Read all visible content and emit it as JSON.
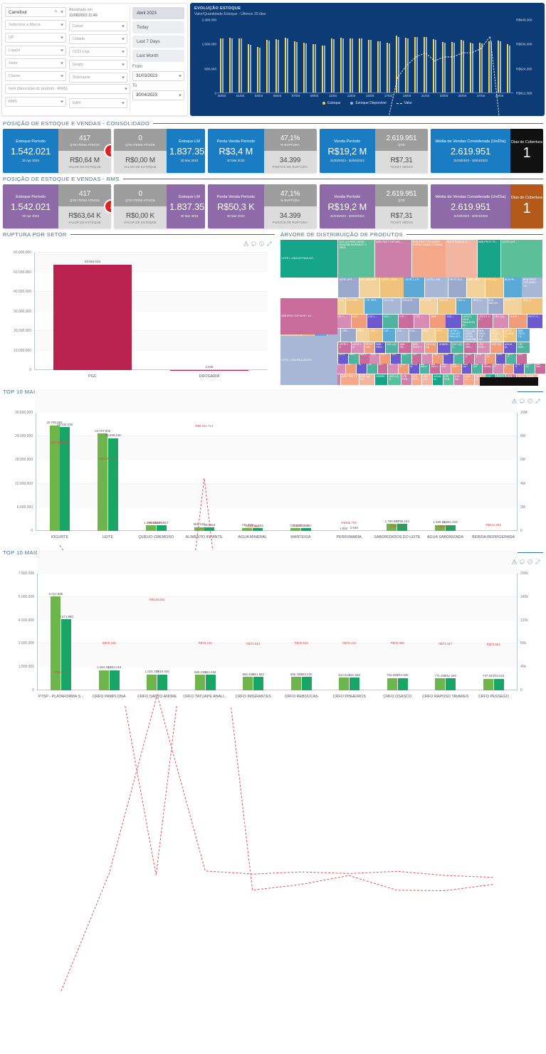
{
  "filters": {
    "account": {
      "value": "Carrefour",
      "placeholder": "Conta"
    },
    "updated": {
      "line1": "Atualizado em",
      "line2": "11/08/2023  11:49"
    },
    "selects": [
      {
        "label": "Selecione a Marca"
      },
      {
        "label": "Canal"
      },
      {
        "label": "UF"
      },
      {
        "label": "Cidade"
      },
      {
        "label": "Loja(s)"
      },
      {
        "label": "COD Loja"
      },
      {
        "label": "Setor"
      },
      {
        "label": "Grupo"
      },
      {
        "label": "Classe"
      },
      {
        "label": "Subclasse"
      }
    ],
    "item_select": {
      "label": "Item (descrição do produto - RMS)"
    },
    "rms_select": {
      "label": "RMS"
    },
    "ean_select": {
      "label": "EAN"
    },
    "presets": [
      "Abril 2023",
      "Today",
      "Last 7 Days",
      "Last Month"
    ],
    "selected_preset": "Abril 2023",
    "from_label": "From",
    "from_value": "31/03/2023",
    "to_label": "To",
    "to_value": "30/04/2023"
  },
  "evolution": {
    "title": "EVOLUÇÃO ESTOQUE",
    "subtitle": "Valor/Quantidade Estoque - Últimos 30 dias",
    "legend": [
      "Estoque",
      "Estoque Disponível",
      "Valor"
    ],
    "chart_data": {
      "type": "bar",
      "title": "EVOLUÇÃO ESTOQUE",
      "xlabel": "",
      "ylabel": "Quantidade Estoque",
      "ylim": [
        0,
        2400000
      ],
      "y_ticks": [
        "0",
        "800.000",
        "1.600.000",
        "2.400.000"
      ],
      "y2_ticks": [
        "R$612.000",
        "R$624.000",
        "R$636.000",
        "R$648.000"
      ],
      "y2lim": [
        612000,
        648000
      ],
      "grid": false,
      "legend_position": "bottom",
      "categories": [
        "30/03",
        "31/03",
        "01/04",
        "02/04",
        "03/04",
        "04/04",
        "05/04",
        "06/04",
        "07/04",
        "08/04",
        "09/04",
        "10/04",
        "11/04",
        "12/04",
        "13/04",
        "14/04",
        "15/04",
        "16/04",
        "17/04",
        "18/04",
        "19/04",
        "20/04",
        "21/04",
        "22/04",
        "23/04",
        "24/04",
        "25/04",
        "26/04",
        "27/04",
        "28/04",
        "29/04",
        "30/04"
      ],
      "tick_labels": [
        "30/03",
        "01/04",
        "03/04",
        "05/04",
        "07/04",
        "09/04",
        "11/04",
        "13/04",
        "15/04",
        "17/04",
        "19/04",
        "21/04",
        "23/04",
        "25/04",
        "27/04",
        "29/04"
      ],
      "series": [
        {
          "name": "Estoque",
          "color": "#f5d547",
          "values": [
            1800000,
            1810000,
            1805000,
            1600000,
            1520000,
            1750000,
            1760000,
            1810000,
            1700000,
            1660000,
            1610000,
            1570000,
            1800000,
            1810000,
            1800000,
            1800000,
            1750000,
            1710000,
            1660000,
            1880000,
            1810000,
            1840000,
            1850000,
            1760000,
            1680000,
            1680000,
            1740000,
            1660000,
            1660000,
            1700000,
            1720000,
            1600000
          ]
        },
        {
          "name": "Estoque Disponível",
          "color": "#8fb8dd",
          "values": [
            1790000,
            1800000,
            1800000,
            1590000,
            1500000,
            1720000,
            1740000,
            1800000,
            1680000,
            1640000,
            1600000,
            1550000,
            1780000,
            1800000,
            1790000,
            1790000,
            1740000,
            1700000,
            1640000,
            1850000,
            1800000,
            1830000,
            1840000,
            1740000,
            1660000,
            1660000,
            1720000,
            1640000,
            1640000,
            1690000,
            1700000,
            1570000
          ]
        },
        {
          "name": "Valor",
          "color": "#ffffff",
          "style": "dashed",
          "values": [
            620000,
            620000,
            620000,
            620000,
            620000,
            620500,
            621000,
            621000,
            621000,
            621500,
            622000,
            631000,
            633000,
            633500,
            634000,
            634500,
            634500,
            634000,
            636000,
            641000,
            642500,
            643500,
            644000,
            643000,
            643500,
            643500,
            644000,
            644000,
            644500,
            646000,
            636000,
            635000
          ]
        }
      ]
    }
  },
  "sections": {
    "consolidado": "POSIÇÃO DE ESTOQUE E VENDAS - CONSOLIDADO",
    "rms": "POSIÇÃO DE ESTOQUE E VENDAS - RMS",
    "ruptura": "RUPTURA POR SETOR",
    "arvore": "ÁRVORE DE DISTRIBUIÇÃO DE PRODUTOS",
    "top_grupo": "TOP 10 MAIORES ESTOQUES POR GRUPO",
    "top_loja": "TOP 10 MAIORES ESTOQUES POR LOJA"
  },
  "kpi_consolidado": {
    "accent": "#1a7dc4",
    "coverage_bg": "#111111",
    "cards": [
      {
        "label": "Estoque Período",
        "value": "1.542.021",
        "sub": "30 Apr 2023",
        "right_top_value": "417",
        "right_top_cap": "QTD ITENS ATIVOS",
        "right_bot_value": "R$0,64 M",
        "right_bot_cap": "VALOR DE ESTOQUE"
      },
      {
        "label": "Estoque LM",
        "value": "1.837.352",
        "sub": "30 Mar 2023",
        "left_top_value": "0",
        "left_top_cap": "QTD ITENS ATIVOS",
        "left_bot_value": "R$0,00 M",
        "left_bot_cap": "VALOR DE ESTOQUE"
      },
      {
        "label": "Perda Venda Período",
        "value": "R$3,4 M",
        "sub": "30 Mar 2023",
        "right_top_value": "47,1%",
        "right_top_cap": "% RUPTURA",
        "right_bot_value": "34.399",
        "right_bot_cap": "PONTOS DE RUPTURA"
      },
      {
        "label": "Venda Período",
        "value": "R$19,2 M",
        "sub": "31/03/2023 - 30/04/2023",
        "right_top_value": "2.619.951",
        "right_top_cap": "QTD",
        "right_bot_value": "R$7,31",
        "right_bot_cap": "TICKET MÉDIO"
      },
      {
        "label": "Média de Vendas Considerada (Un/Dia)",
        "value": "2.619.951",
        "sub": "31/03/2023 - 30/04/2023",
        "coverage_label": "Dias de Cobertura",
        "coverage_value": "1"
      }
    ]
  },
  "kpi_rms": {
    "accent": "#8e6ba8",
    "coverage_bg": "#b5591a",
    "cards": [
      {
        "label": "Estoque Período",
        "value": "1.542.021",
        "sub": "30 Apr 2023",
        "right_top_value": "417",
        "right_top_cap": "QTD ITENS ATIVOS",
        "right_bot_value": "R$63,64 K",
        "right_bot_cap": "VALOR DE ESTOQUE"
      },
      {
        "label": "Estoque LM",
        "value": "1.837.352",
        "sub": "30 Mar 2023",
        "left_top_value": "0",
        "left_top_cap": "QTD ITENS ATIVOS",
        "left_bot_value": "R$0,00 K",
        "left_bot_cap": "VALOR DE ESTOQUE"
      },
      {
        "label": "Perda Venda Período",
        "value": "R$50,3 K",
        "sub": "30 Mar 2023",
        "right_top_value": "47,1%",
        "right_top_cap": "% RUPTURA",
        "right_bot_value": "34.399",
        "right_bot_cap": "PONTOS DE RUPTURA"
      },
      {
        "label": "Venda Período",
        "value": "R$19,2 M",
        "sub": "31/03/2023 - 30/04/2023",
        "right_top_value": "2.619.951",
        "right_top_cap": "QTD",
        "right_bot_value": "R$7,31",
        "right_bot_cap": "TICKET MÉDIO"
      },
      {
        "label": "Média de Vendas Considerada (Un/Dia)",
        "value": "2.619.951",
        "sub": "31/03/2023 - 30/04/2023",
        "coverage_label": "Dias de Cobertura",
        "coverage_value": "1"
      }
    ]
  },
  "ruptura_chart": {
    "chart_data": {
      "type": "bar",
      "title": "RUPTURA POR SETOR",
      "xlabel": "",
      "ylabel": "",
      "ylim": [
        0,
        60000000
      ],
      "grid": true,
      "legend_position": "none",
      "y_ticks": [
        "0",
        "10.000.000",
        "20.000.000",
        "30.000.000",
        "40.000.000",
        "50.000.000",
        "60.000.000"
      ],
      "categories": [
        "PGC",
        "DROGARIA"
      ],
      "values": [
        53693615,
        2948
      ],
      "value_labels": [
        "53.693.615",
        "2.948"
      ],
      "color": "#b9214f"
    }
  },
  "treemap": {
    "chart_data": {
      "type": "heatmap",
      "title": "ÁRVORE DE DISTRIBUIÇÃO DE PRODUTOS",
      "labels": [
        "LEITE L VIDA INT PAULIST...",
        "IOG LIQ PARC DESN DANONE MORANGO 1 25KG",
        "BEB PROT TGP WH...",
        "BEB PROT TGP WHEY YOPRO MORA TP 250ML",
        "PETIT SUISSE D...",
        "BEB PROT TS...",
        "LEITE UHT ...",
        "LEITE UHT ...",
        "IOG NATURA...",
        "LEITE L VIDA...",
        "LEITE L V P...",
        "LEITE L VID...",
        "PETIT SUI...",
        "BEB PRO...",
        "IOG LIQ ...",
        "BEB PR...",
        "BEB PROT TGP WHEY YO...",
        "IOG LIQ DA...",
        "SOBRE...",
        "IOG LIQ S ...",
        "LTE FER...",
        "LTE FER...",
        "IOG LIQ ...",
        "AGUA M...",
        "LTE FER...",
        "IOG NA...",
        "IOG LI...",
        "REQ C...",
        "IOG NATUR...",
        "PETIT S...",
        "IOG LI...",
        "PETIT ...",
        "BEB IO...",
        "LTE F...",
        "IOG L...",
        "ACH...",
        "IOG L...",
        "IOG...",
        "LTE ...",
        "LTE ...",
        "BEB ...",
        "IOG ...",
        "LEITE L VIDA PAULISTA IN...",
        "LEITE L V P...",
        "IOG LIQ...",
        "LEITE ...",
        "PETIT S...",
        "MAN...",
        "SOBR...",
        "CREA...",
        "LTE ...",
        "CRE...",
        "PRTL...",
        "IOG ...",
        "LTE ...",
        "LTE ...",
        "IOG ...",
        "IOG ...",
        "LEIT..."
      ]
    }
  },
  "top_grupo_chart": {
    "chart_data": {
      "type": "bar",
      "title": "TOP 10 MAIORES ESTOQUES POR GRUPO",
      "xlabel": "",
      "ylabel": "",
      "ylim": [
        0,
        30000000
      ],
      "y2lim": [
        0,
        10000000
      ],
      "grid": true,
      "legend_position": "none",
      "y_ticks": [
        "0",
        "6.000.000",
        "12.000.000",
        "18.000.000",
        "24.000.000",
        "30.000.000"
      ],
      "y2_ticks": [
        "0",
        "2M",
        "4M",
        "6M",
        "8M",
        "10M"
      ],
      "categories": [
        "IOGURTE",
        "LEITE",
        "QUEIJO CREMOSO",
        "ALIMENTO INFANTIL",
        "AGUA MINERAL",
        "MANTEIGA",
        "PERFUMARIA",
        "SABORIZADOS DO LEITE",
        "AGUA SABORIZADA",
        "BEBIDA REFRIGERADA"
      ],
      "series": [
        {
          "name": "Estoque",
          "color": "#6eb64b",
          "values": [
            26765602,
            24707506,
            1396338,
            908123,
            735896,
            724920,
            1562,
            1789933,
            1489861,
            0
          ],
          "labels": [
            "26.765.602",
            "24.707.506",
            "1.396.338",
            "908.123",
            "735.896",
            "724.920",
            "1.562",
            "1.789.933",
            "1.489.861",
            ""
          ]
        },
        {
          "name": "Estoque Disponível",
          "color": "#18a566",
          "values": [
            26334035,
            23539196,
            1401857,
            863853,
            721164,
            710367,
            2948,
            1796154,
            1481493,
            0
          ],
          "labels": [
            "26.334.035",
            "23.539.196",
            "1.401.857",
            "863.853",
            "721.164",
            "710.367",
            "2.948",
            "1.796.154",
            "1.481.493",
            ""
          ]
        }
      ],
      "line": {
        "name": "Valor",
        "color": "#e8505b",
        "style": "dashed",
        "values": [
          7246211,
          5864812,
          401857,
          8641714,
          93000,
          210158,
          395709,
          89931,
          81290,
          212092
        ],
        "labels": [
          "R$7.246.211",
          "R$5.864.812",
          "R$401.857",
          "R$8.641.714",
          "R$93.000",
          "R$210.158",
          "R$395.709",
          "R$89.931",
          "R$81.290",
          "R$212.092"
        ]
      }
    }
  },
  "top_loja_chart": {
    "chart_data": {
      "type": "bar",
      "title": "TOP 10 MAIORES ESTOQUES POR LOJA",
      "xlabel": "",
      "ylabel": "",
      "ylim": [
        0,
        7500000
      ],
      "y2lim": [
        0,
        200000
      ],
      "grid": true,
      "legend_position": "none",
      "y_ticks": [
        "0",
        "1.500.000",
        "3.000.000",
        "4.500.000",
        "6.000.000",
        "7.500.000"
      ],
      "y2_ticks": [
        "0",
        "40k",
        "80k",
        "120k",
        "160k",
        "200k"
      ],
      "categories": [
        "PTSP - PLATAFORMA S...",
        "CRFO PAMPLONA",
        "CRFO SANTO ANDRE",
        "CRFO TATUAPE ANALI...",
        "CRFO IMIGRANTES",
        "CRFO REBOUCAS",
        "CRFO PINHEIROS",
        "CRFO OSASCO",
        "CRFO RAPOSO TAVARES",
        "CRFO PESSEGO"
      ],
      "series": [
        {
          "name": "Estoque",
          "color": "#6eb64b",
          "values": [
            6017885,
            1284143,
            1025728,
            989238,
            866468,
            865780,
            814513,
            792558,
            771396,
            737547
          ],
          "labels": [
            "6.017.885",
            "1.284.143",
            "1.025.728",
            "989.238",
            "866.468",
            "865.780",
            "814.513",
            "792.558",
            "771.396",
            "737.547"
          ]
        },
        {
          "name": "Estoque Disponível",
          "color": "#18a566",
          "values": [
            4571980,
            1283218,
            1018836,
            984368,
            861862,
            863430,
            810968,
            783306,
            762260,
            733815
          ],
          "labels": [
            "4.571.980",
            "1.283.218",
            "1.018.836",
            "984.368",
            "861.862",
            "863.430",
            "810.968",
            "783.306",
            "762.260",
            "733.815"
          ]
        }
      ],
      "line": {
        "name": "Valor",
        "color": "#e8505b",
        "style": "dashed",
        "values": [
          26160,
          75108,
          149564,
          76215,
          74914,
          75815,
          75131,
          76068,
          74317,
          73561
        ],
        "labels": [
          "R$26.160",
          "R$75.108",
          "R$149.564",
          "R$76.215",
          "R$74.914",
          "R$75.815",
          "R$75.131",
          "R$76.068",
          "R$74.317",
          "R$73.561"
        ]
      }
    }
  },
  "icons": {
    "alert": "alert-icon",
    "comment": "comment-icon",
    "info": "info-icon",
    "expand": "expand-icon"
  }
}
